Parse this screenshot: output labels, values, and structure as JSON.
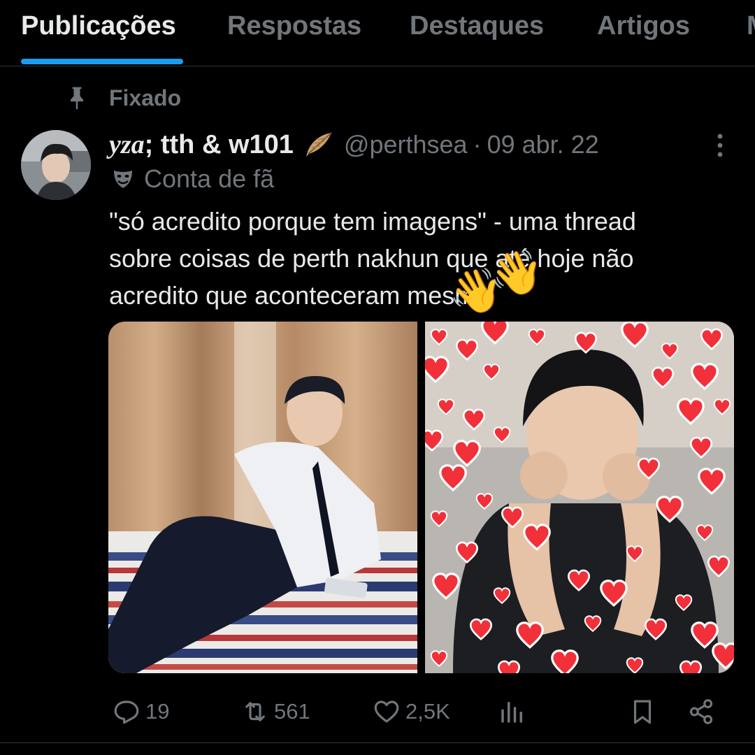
{
  "tabs": [
    {
      "label": "Publicações",
      "active": true
    },
    {
      "label": "Respostas",
      "active": false
    },
    {
      "label": "Destaques",
      "active": false
    },
    {
      "label": "Artigos",
      "active": false
    },
    {
      "label": "M",
      "active": false
    }
  ],
  "pinned": {
    "label": "Fixado",
    "icon": "pin-icon"
  },
  "tweet": {
    "author_name_italic": "yza",
    "author_name_rest": "; tth & w101",
    "name_emoji_icon": "feather-quill-icon",
    "handle": "@perthsea",
    "separator": "·",
    "date": "09 abr. 22",
    "label": "Conta de fã",
    "label_icon": "theater-masks-icon",
    "text_lines": [
      "\"só acredito porque tem imagens\" - uma thread",
      "sobre coisas de perth nakhun que até hoje não",
      "acredito que aconteceram mesmo"
    ],
    "overlay_emoji": "👋",
    "images": [
      {
        "description_icon": "photo-man-in-shirt-and-tie"
      },
      {
        "description_icon": "photo-man-with-hearts"
      }
    ]
  },
  "actions": {
    "reply_count": "19",
    "retweet_count": "561",
    "like_count": "2,5K",
    "views_icon": "views-bar-icon",
    "bookmark_icon": "bookmark-icon",
    "share_icon": "share-icon"
  },
  "colors": {
    "background": "#000000",
    "text_primary": "#e7e9ea",
    "text_secondary": "#71767b",
    "accent": "#1d9bf0",
    "border": "#2f3336"
  }
}
